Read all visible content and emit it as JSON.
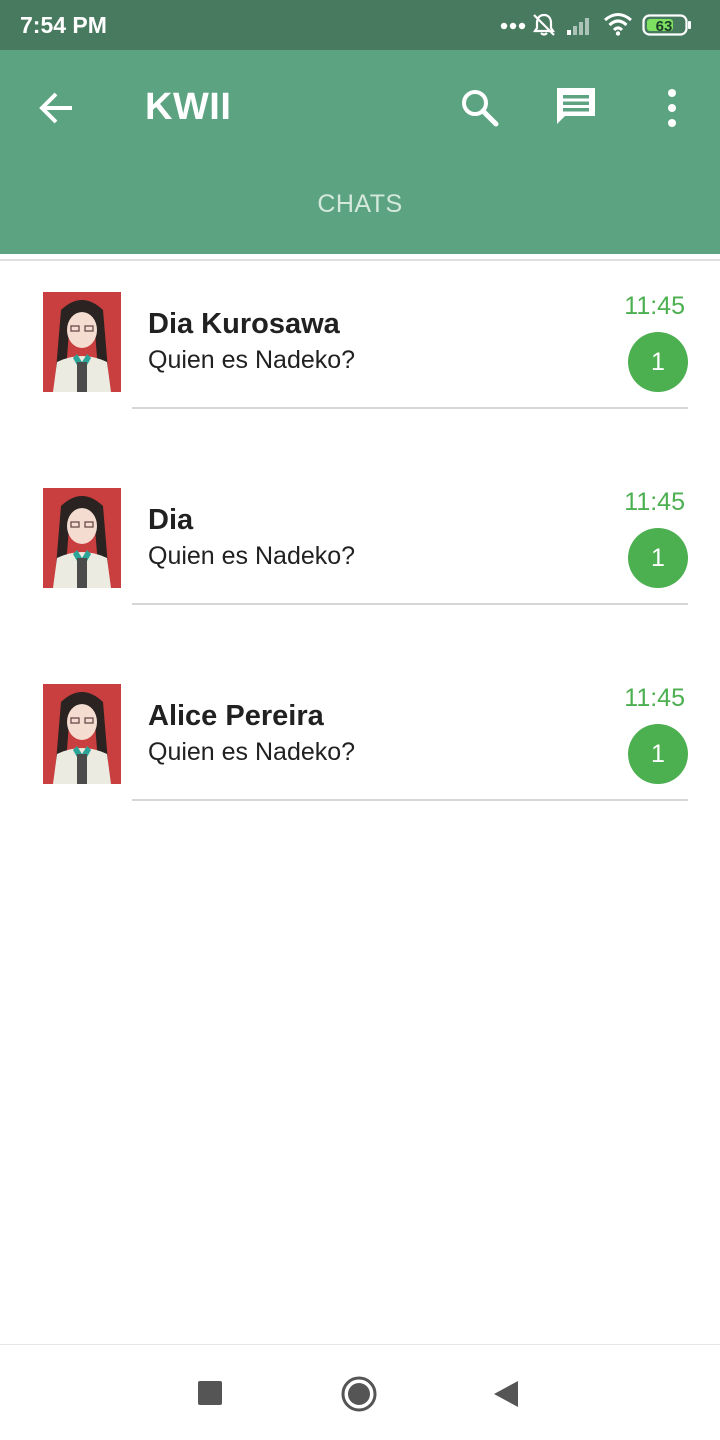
{
  "status_bar": {
    "time": "7:54 PM",
    "battery": "63",
    "icons": [
      "more-dots-icon",
      "bell-off-icon",
      "signal-icon",
      "wifi-icon",
      "battery-icon"
    ]
  },
  "app_bar": {
    "title": "KWII",
    "icons": [
      "back-arrow-icon",
      "search-icon",
      "message-icon",
      "more-vert-icon"
    ],
    "tabs": [
      {
        "label": "CHATS"
      }
    ]
  },
  "chats": [
    {
      "name": "Dia Kurosawa",
      "preview": "Quien es Nadeko?",
      "time": "11:45",
      "unread": "1"
    },
    {
      "name": "Dia",
      "preview": "Quien es Nadeko?",
      "time": "11:45",
      "unread": "1"
    },
    {
      "name": "Alice Pereira",
      "preview": "Quien es Nadeko?",
      "time": "11:45",
      "unread": "1"
    }
  ],
  "colors": {
    "status_bar": "#487a60",
    "app_bar": "#5ca381",
    "accent_green": "#4caf50",
    "avatar_bg": "#c93e3e"
  },
  "nav_bar": {
    "icons": [
      "recent-apps-icon",
      "home-icon",
      "back-triangle-icon"
    ]
  }
}
